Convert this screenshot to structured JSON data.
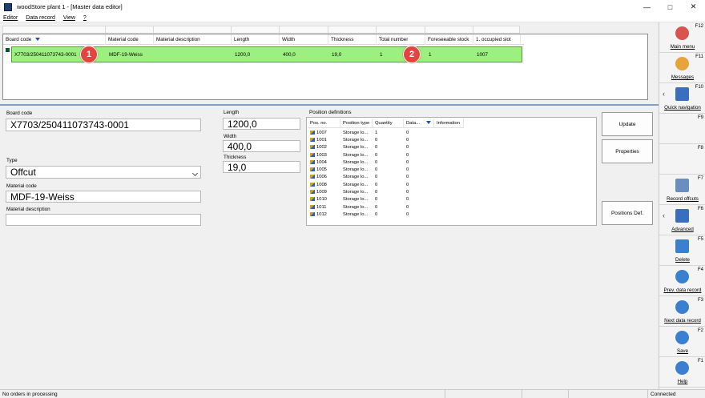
{
  "window": {
    "title": "woodStore plant 1 - [Master data editor]"
  },
  "menu": [
    "Editor",
    "Data record",
    "View",
    "?"
  ],
  "grid": {
    "columns": [
      "Board code",
      "Material code",
      "Material description",
      "Length",
      "Width",
      "Thickness",
      "Total number",
      "Foreseeable stock",
      "1. occupied slot"
    ],
    "row": {
      "board_code": "X7703/250411073743-0001",
      "material_code": "MDF-19-Weiss",
      "material_description": "",
      "length": "1200,0",
      "width": "400,0",
      "thickness": "19,0",
      "total_number": "1",
      "foreseeable_stock": "1",
      "occupied_slot": "1007"
    },
    "badge1": "1",
    "badge2": "2"
  },
  "form": {
    "board_code_label": "Board code",
    "board_code": "X7703/250411073743-0001",
    "type_label": "Type",
    "type": "Offcut",
    "material_code_label": "Material code",
    "material_code": "MDF-19-Weiss",
    "material_description_label": "Material description",
    "material_description": "",
    "length_label": "Length",
    "length": "1200,0",
    "width_label": "Width",
    "width": "400,0",
    "thickness_label": "Thickness",
    "thickness": "19,0"
  },
  "positions": {
    "label": "Position definitions",
    "columns": [
      "Pos. no.",
      "Position type",
      "Quantity",
      "Data...",
      "Information"
    ],
    "rows": [
      {
        "pos": "1007",
        "type": "Storage lo...",
        "qty": "1",
        "data": "0"
      },
      {
        "pos": "1001",
        "type": "Storage lo...",
        "qty": "0",
        "data": "0"
      },
      {
        "pos": "1002",
        "type": "Storage lo...",
        "qty": "0",
        "data": "0"
      },
      {
        "pos": "1003",
        "type": "Storage lo...",
        "qty": "0",
        "data": "0"
      },
      {
        "pos": "1004",
        "type": "Storage lo...",
        "qty": "0",
        "data": "0"
      },
      {
        "pos": "1005",
        "type": "Storage lo...",
        "qty": "0",
        "data": "0"
      },
      {
        "pos": "1006",
        "type": "Storage lo...",
        "qty": "0",
        "data": "0"
      },
      {
        "pos": "1008",
        "type": "Storage lo...",
        "qty": "0",
        "data": "0"
      },
      {
        "pos": "1009",
        "type": "Storage lo...",
        "qty": "0",
        "data": "0"
      },
      {
        "pos": "1010",
        "type": "Storage lo...",
        "qty": "0",
        "data": "0"
      },
      {
        "pos": "1011",
        "type": "Storage lo...",
        "qty": "0",
        "data": "0"
      },
      {
        "pos": "1012",
        "type": "Storage lo...",
        "qty": "0",
        "data": "0"
      }
    ]
  },
  "buttons": {
    "update": "Update",
    "properties": "Properties",
    "positions_def": "Positions Def."
  },
  "sidebar": [
    {
      "key": "F12",
      "label": "Main menu",
      "icon": "close-circle-icon",
      "color": "#d9534f"
    },
    {
      "key": "F11",
      "label": "Messages",
      "icon": "messages-icon",
      "color": "#e8a33a"
    },
    {
      "key": "F10",
      "label": "Quick navigation",
      "icon": "quick-navigation-icon",
      "color": "#3a6fc0"
    },
    {
      "key": "F9",
      "label": "",
      "icon": "",
      "color": ""
    },
    {
      "key": "F8",
      "label": "",
      "icon": "",
      "color": ""
    },
    {
      "key": "F7",
      "label": "Record offcuts",
      "icon": "record-offcuts-icon",
      "color": "#6a8fbf"
    },
    {
      "key": "F6",
      "label": "Advanced",
      "icon": "advanced-grid-icon",
      "color": "#3a6fc0"
    },
    {
      "key": "F5",
      "label": "Delete",
      "icon": "trash-icon",
      "color": "#3a7fd0"
    },
    {
      "key": "F4",
      "label": "Prev. data record",
      "icon": "prev-arrow-icon",
      "color": "#3a7fd0"
    },
    {
      "key": "F3",
      "label": "Next data record",
      "icon": "next-arrow-icon",
      "color": "#3a7fd0"
    },
    {
      "key": "F2",
      "label": "Save",
      "icon": "save-check-icon",
      "color": "#3a7fd0"
    },
    {
      "key": "F1",
      "label": "Help",
      "icon": "help-icon",
      "color": "#3a7fd0"
    }
  ],
  "status": {
    "left": "No orders in processing",
    "right": "Connected"
  }
}
